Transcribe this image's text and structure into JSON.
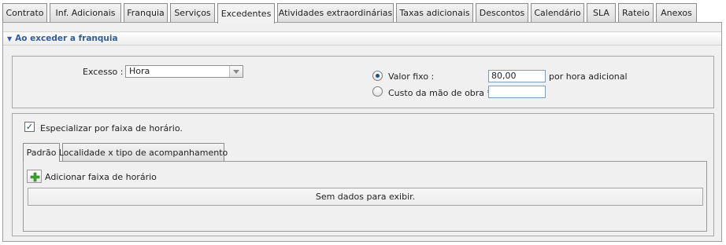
{
  "tabs": [
    {
      "label": "Contrato"
    },
    {
      "label": "Inf. Adicionais"
    },
    {
      "label": "Franquia"
    },
    {
      "label": "Serviços"
    },
    {
      "label": "Excedentes",
      "active": true
    },
    {
      "label": "Atividades extraordinárias"
    },
    {
      "label": "Taxas adicionais"
    },
    {
      "label": "Descontos"
    },
    {
      "label": "Calendário"
    },
    {
      "label": "SLA"
    },
    {
      "label": "Rateio"
    },
    {
      "label": "Anexos"
    }
  ],
  "section": {
    "title": "Ao exceder a franquia"
  },
  "excess": {
    "label": "Excesso :",
    "selected": "Hora",
    "options": [
      {
        "label": "Valor fixo :",
        "value": "80,00",
        "suffix": "por hora adicional",
        "selected": true
      },
      {
        "label": "Custo da mão de obra *",
        "value": "",
        "selected": false
      }
    ]
  },
  "specialize": {
    "label": "Especializar por faixa de horário.",
    "checked": true,
    "subtabs": [
      {
        "label": "Padrão",
        "active": true
      },
      {
        "label": "Localidade x tipo de acompanhamento"
      }
    ],
    "add_label": "Adicionar faixa de horário",
    "empty_text": "Sem dados para exibir."
  },
  "colors": {
    "header_text": "#2f5f9a",
    "panel_bg": "#f0f0f0",
    "add_icon": "#3aa52a"
  }
}
